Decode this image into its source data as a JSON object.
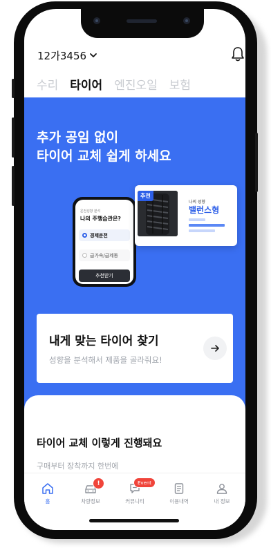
{
  "header": {
    "plate_number": "12가3456",
    "icons": {
      "plate_dropdown": "chevron-down-icon",
      "notifications": "bell-icon"
    }
  },
  "tabs": [
    {
      "label": "수리",
      "active": false
    },
    {
      "label": "타이어",
      "active": true
    },
    {
      "label": "엔진오일",
      "active": false
    },
    {
      "label": "보험",
      "active": false
    }
  ],
  "hero": {
    "title": "추가 공임 없이\n타이어 교체 쉽게 하세요",
    "background": "#3a6ff2",
    "illustration": {
      "survey": {
        "subtitle": "운전성향 분석",
        "question": "나의 주행습관은?",
        "options": [
          {
            "label": "경제운전",
            "selected": true
          },
          {
            "label": "급가속/급제동",
            "selected": false
          }
        ],
        "button_label": "추천받기"
      },
      "recommendation": {
        "badge": "추천",
        "caption": "나의 성향",
        "result": "밸런스형"
      }
    }
  },
  "find_card": {
    "title": "내게 맞는 타이어 찾기",
    "subtitle": "성향을 분석해서 제품을 골라줘요!",
    "icon": "arrow-right-icon"
  },
  "process": {
    "title": "타이어 교체 이렇게 진행돼요",
    "subtitle": "구매부터 장착까지 한번에"
  },
  "bottom_nav": [
    {
      "label": "홈",
      "icon": "home-icon",
      "active": true
    },
    {
      "label": "차량정보",
      "icon": "car-icon",
      "badge": "!"
    },
    {
      "label": "커뮤니티",
      "icon": "community-icon",
      "badge": "Event"
    },
    {
      "label": "이용내역",
      "icon": "history-icon"
    },
    {
      "label": "내 정보",
      "icon": "profile-icon"
    }
  ],
  "colors": {
    "accent": "#3a6ff2",
    "badge_red": "#f0443a",
    "text_dark": "#111111"
  }
}
